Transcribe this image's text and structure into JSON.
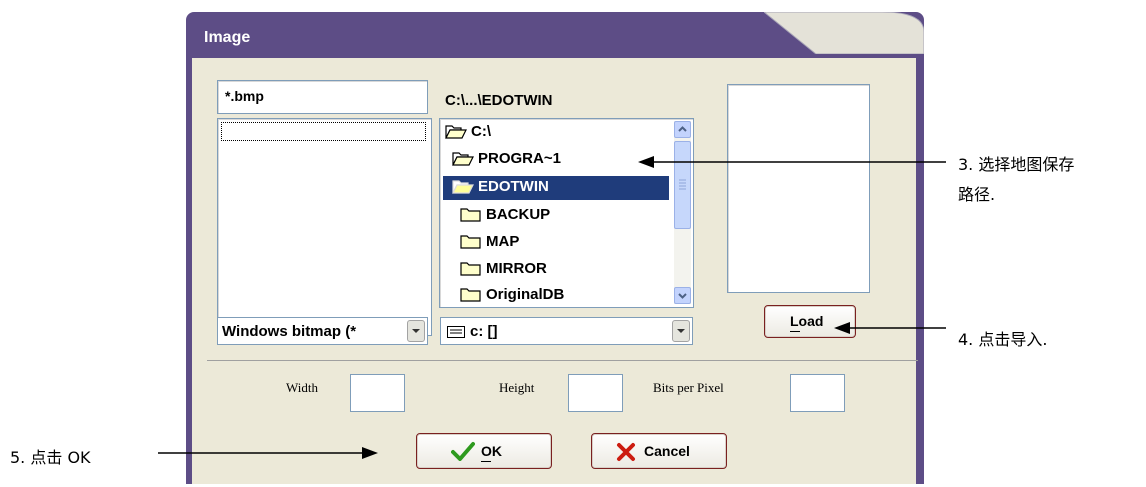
{
  "dialog": {
    "title": "Image"
  },
  "file_filter": {
    "value": "*.bmp"
  },
  "current_path": "C:\\...\\EDOTWIN",
  "directories": [
    {
      "label": "C:\\",
      "indent": 0,
      "open": true,
      "selected": false
    },
    {
      "label": "PROGRA~1",
      "indent": 1,
      "open": true,
      "selected": false
    },
    {
      "label": "EDOTWIN",
      "indent": 2,
      "open": true,
      "selected": true
    },
    {
      "label": "BACKUP",
      "indent": 3,
      "open": false,
      "selected": false
    },
    {
      "label": "MAP",
      "indent": 3,
      "open": false,
      "selected": false
    },
    {
      "label": "MIRROR",
      "indent": 3,
      "open": false,
      "selected": false
    },
    {
      "label": "OriginalDB",
      "indent": 3,
      "open": false,
      "selected": false
    }
  ],
  "file_type": {
    "value": "Windows bitmap (*"
  },
  "drive": {
    "value": "c: []"
  },
  "buttons": {
    "load": "Load",
    "ok": "OK",
    "cancel": "Cancel"
  },
  "dimensions": {
    "width_label": "Width",
    "height_label": "Height",
    "bpp_label": "Bits per Pixel"
  },
  "annotations": {
    "step3_line1": "3. 选择地图保存",
    "step3_line2": "路径.",
    "step4": "4. 点击导入.",
    "step5": "5. 点击 OK"
  },
  "colors": {
    "title_bar": "#5d4d86",
    "selection": "#1f3c7b",
    "dialog_bg": "#ece9d8",
    "ok_check": "#2e9a1e",
    "cancel_x": "#cc1c10"
  }
}
